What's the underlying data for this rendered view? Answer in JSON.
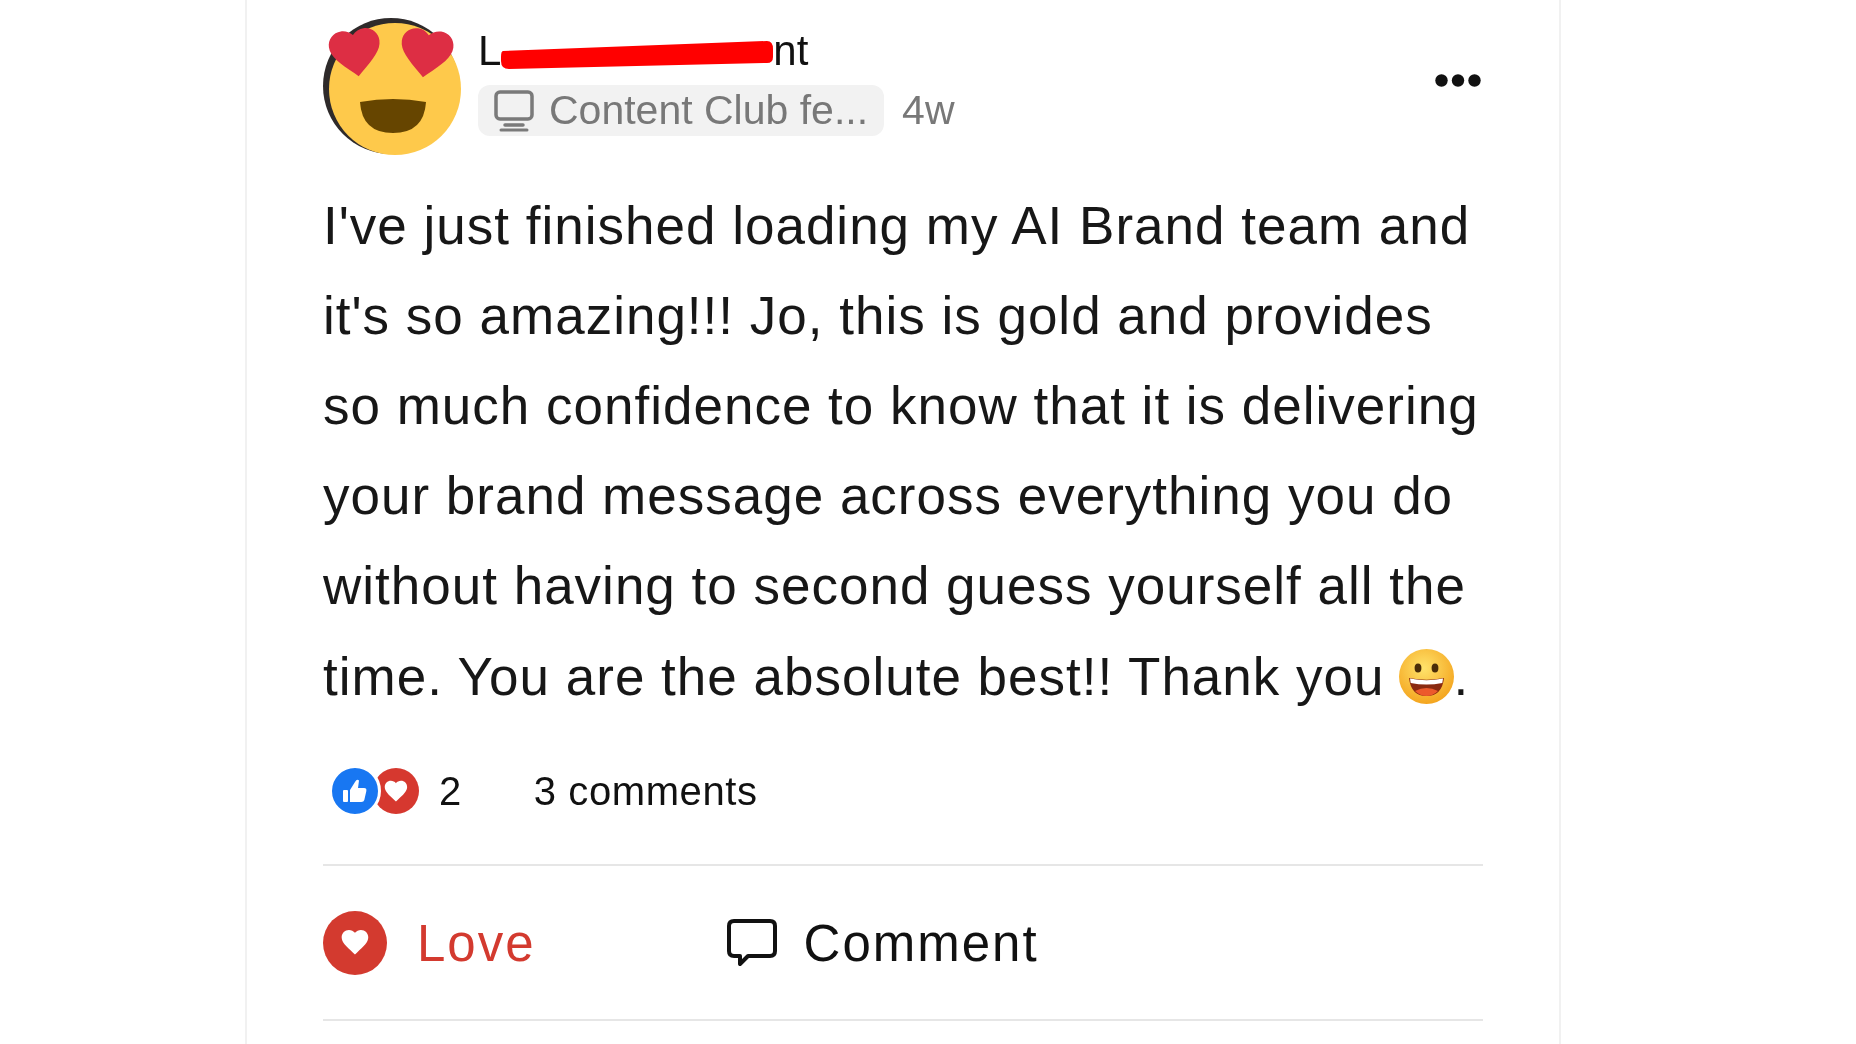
{
  "post": {
    "author": {
      "name_start": "L",
      "name_end": "nt",
      "redacted": true
    },
    "community": "Content Club fe...",
    "time": "4w",
    "body": {
      "text": "I've just finished loading my AI Brand team and it's so amazing!!! Jo, this is gold and provides so much confidence to know that it is delivering your brand message across everything you do without having to second guess yourself all the",
      "last_line": "time. You are the absolute best!! Thank you",
      "ending": "."
    },
    "reactions": {
      "count": "2"
    },
    "comments": "3 comments",
    "actions": [
      {
        "kind": "love",
        "label": "Love",
        "active": true
      },
      {
        "kind": "comment",
        "label": "Comment",
        "active": false
      }
    ]
  }
}
